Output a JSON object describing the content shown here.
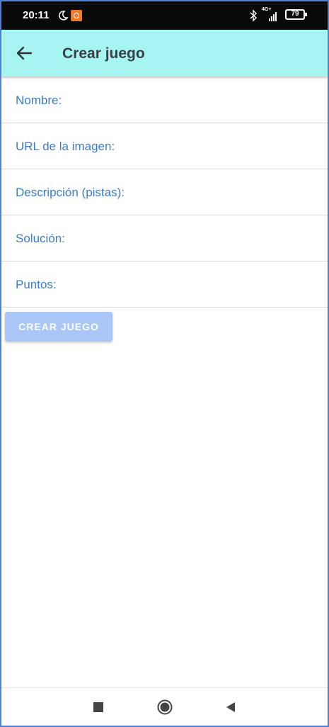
{
  "status_bar": {
    "time": "20:11",
    "network": "4G+",
    "battery": "79"
  },
  "app_bar": {
    "title": "Crear juego"
  },
  "form": {
    "fields": [
      {
        "label": "Nombre:"
      },
      {
        "label": "URL de la imagen:"
      },
      {
        "label": "Descripción (pistas):"
      },
      {
        "label": "Solución:"
      },
      {
        "label": "Puntos:"
      }
    ],
    "submit_label": "CREAR JUEGO"
  },
  "colors": {
    "app_bar": "#a7f5f3",
    "label": "#3d7cc9",
    "button": "#a9c6f7"
  }
}
